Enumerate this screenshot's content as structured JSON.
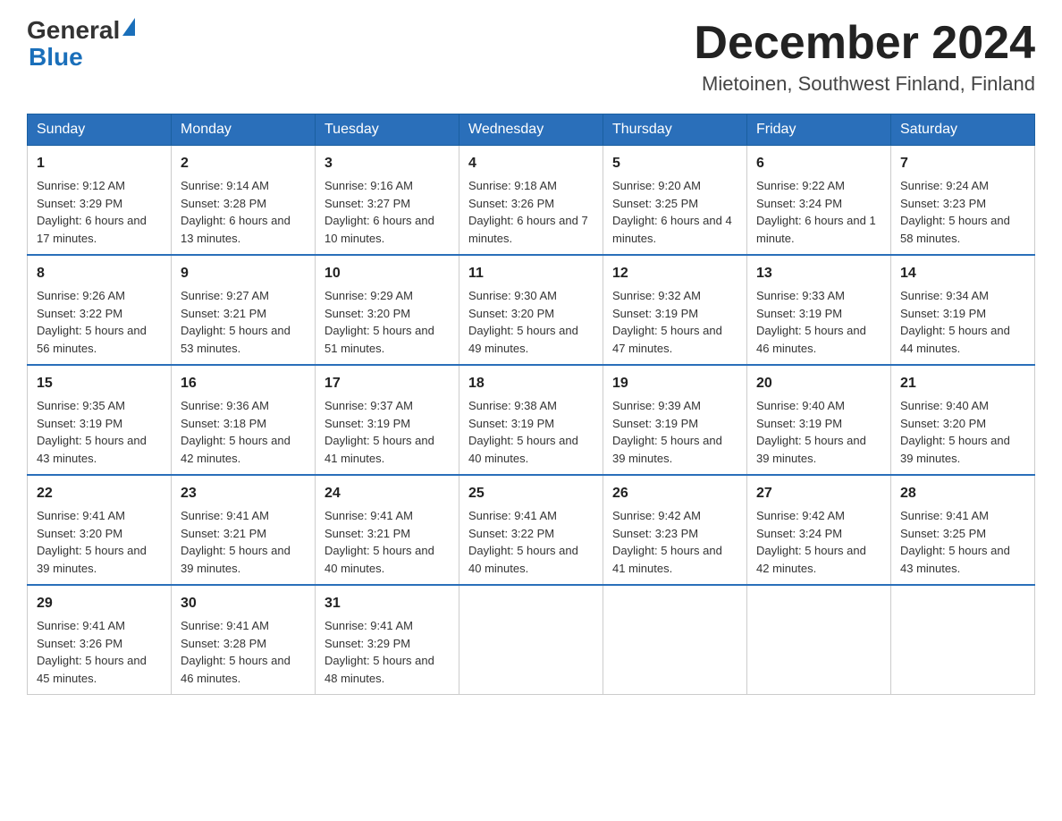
{
  "header": {
    "logo": {
      "part1": "General",
      "part2": "Blue"
    },
    "title": "December 2024",
    "location": "Mietoinen, Southwest Finland, Finland"
  },
  "weekdays": [
    "Sunday",
    "Monday",
    "Tuesday",
    "Wednesday",
    "Thursday",
    "Friday",
    "Saturday"
  ],
  "weeks": [
    [
      {
        "day": "1",
        "sunrise": "9:12 AM",
        "sunset": "3:29 PM",
        "daylight": "6 hours and 17 minutes."
      },
      {
        "day": "2",
        "sunrise": "9:14 AM",
        "sunset": "3:28 PM",
        "daylight": "6 hours and 13 minutes."
      },
      {
        "day": "3",
        "sunrise": "9:16 AM",
        "sunset": "3:27 PM",
        "daylight": "6 hours and 10 minutes."
      },
      {
        "day": "4",
        "sunrise": "9:18 AM",
        "sunset": "3:26 PM",
        "daylight": "6 hours and 7 minutes."
      },
      {
        "day": "5",
        "sunrise": "9:20 AM",
        "sunset": "3:25 PM",
        "daylight": "6 hours and 4 minutes."
      },
      {
        "day": "6",
        "sunrise": "9:22 AM",
        "sunset": "3:24 PM",
        "daylight": "6 hours and 1 minute."
      },
      {
        "day": "7",
        "sunrise": "9:24 AM",
        "sunset": "3:23 PM",
        "daylight": "5 hours and 58 minutes."
      }
    ],
    [
      {
        "day": "8",
        "sunrise": "9:26 AM",
        "sunset": "3:22 PM",
        "daylight": "5 hours and 56 minutes."
      },
      {
        "day": "9",
        "sunrise": "9:27 AM",
        "sunset": "3:21 PM",
        "daylight": "5 hours and 53 minutes."
      },
      {
        "day": "10",
        "sunrise": "9:29 AM",
        "sunset": "3:20 PM",
        "daylight": "5 hours and 51 minutes."
      },
      {
        "day": "11",
        "sunrise": "9:30 AM",
        "sunset": "3:20 PM",
        "daylight": "5 hours and 49 minutes."
      },
      {
        "day": "12",
        "sunrise": "9:32 AM",
        "sunset": "3:19 PM",
        "daylight": "5 hours and 47 minutes."
      },
      {
        "day": "13",
        "sunrise": "9:33 AM",
        "sunset": "3:19 PM",
        "daylight": "5 hours and 46 minutes."
      },
      {
        "day": "14",
        "sunrise": "9:34 AM",
        "sunset": "3:19 PM",
        "daylight": "5 hours and 44 minutes."
      }
    ],
    [
      {
        "day": "15",
        "sunrise": "9:35 AM",
        "sunset": "3:19 PM",
        "daylight": "5 hours and 43 minutes."
      },
      {
        "day": "16",
        "sunrise": "9:36 AM",
        "sunset": "3:18 PM",
        "daylight": "5 hours and 42 minutes."
      },
      {
        "day": "17",
        "sunrise": "9:37 AM",
        "sunset": "3:19 PM",
        "daylight": "5 hours and 41 minutes."
      },
      {
        "day": "18",
        "sunrise": "9:38 AM",
        "sunset": "3:19 PM",
        "daylight": "5 hours and 40 minutes."
      },
      {
        "day": "19",
        "sunrise": "9:39 AM",
        "sunset": "3:19 PM",
        "daylight": "5 hours and 39 minutes."
      },
      {
        "day": "20",
        "sunrise": "9:40 AM",
        "sunset": "3:19 PM",
        "daylight": "5 hours and 39 minutes."
      },
      {
        "day": "21",
        "sunrise": "9:40 AM",
        "sunset": "3:20 PM",
        "daylight": "5 hours and 39 minutes."
      }
    ],
    [
      {
        "day": "22",
        "sunrise": "9:41 AM",
        "sunset": "3:20 PM",
        "daylight": "5 hours and 39 minutes."
      },
      {
        "day": "23",
        "sunrise": "9:41 AM",
        "sunset": "3:21 PM",
        "daylight": "5 hours and 39 minutes."
      },
      {
        "day": "24",
        "sunrise": "9:41 AM",
        "sunset": "3:21 PM",
        "daylight": "5 hours and 40 minutes."
      },
      {
        "day": "25",
        "sunrise": "9:41 AM",
        "sunset": "3:22 PM",
        "daylight": "5 hours and 40 minutes."
      },
      {
        "day": "26",
        "sunrise": "9:42 AM",
        "sunset": "3:23 PM",
        "daylight": "5 hours and 41 minutes."
      },
      {
        "day": "27",
        "sunrise": "9:42 AM",
        "sunset": "3:24 PM",
        "daylight": "5 hours and 42 minutes."
      },
      {
        "day": "28",
        "sunrise": "9:41 AM",
        "sunset": "3:25 PM",
        "daylight": "5 hours and 43 minutes."
      }
    ],
    [
      {
        "day": "29",
        "sunrise": "9:41 AM",
        "sunset": "3:26 PM",
        "daylight": "5 hours and 45 minutes."
      },
      {
        "day": "30",
        "sunrise": "9:41 AM",
        "sunset": "3:28 PM",
        "daylight": "5 hours and 46 minutes."
      },
      {
        "day": "31",
        "sunrise": "9:41 AM",
        "sunset": "3:29 PM",
        "daylight": "5 hours and 48 minutes."
      },
      null,
      null,
      null,
      null
    ]
  ]
}
